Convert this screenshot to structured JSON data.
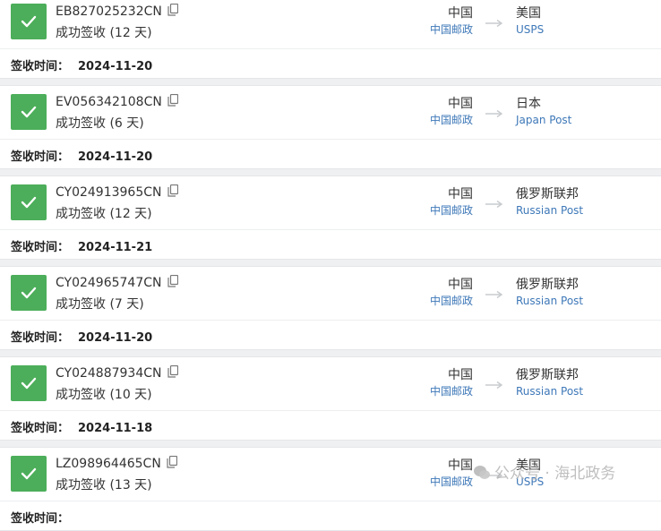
{
  "signed_label": "签收时间：",
  "shipments": [
    {
      "tracking_number": "EB827025232CN",
      "status": "成功签收 (12 天)",
      "origin_country": "中国",
      "origin_carrier": "中国邮政",
      "dest_country": "美国",
      "dest_carrier": "USPS",
      "signed_date": "2024-11-20"
    },
    {
      "tracking_number": "EV056342108CN",
      "status": "成功签收 (6 天)",
      "origin_country": "中国",
      "origin_carrier": "中国邮政",
      "dest_country": "日本",
      "dest_carrier": "Japan Post",
      "signed_date": "2024-11-20"
    },
    {
      "tracking_number": "CY024913965CN",
      "status": "成功签收 (12 天)",
      "origin_country": "中国",
      "origin_carrier": "中国邮政",
      "dest_country": "俄罗斯联邦",
      "dest_carrier": "Russian Post",
      "signed_date": "2024-11-21"
    },
    {
      "tracking_number": "CY024965747CN",
      "status": "成功签收 (7 天)",
      "origin_country": "中国",
      "origin_carrier": "中国邮政",
      "dest_country": "俄罗斯联邦",
      "dest_carrier": "Russian Post",
      "signed_date": "2024-11-20"
    },
    {
      "tracking_number": "CY024887934CN",
      "status": "成功签收 (10 天)",
      "origin_country": "中国",
      "origin_carrier": "中国邮政",
      "dest_country": "俄罗斯联邦",
      "dest_carrier": "Russian Post",
      "signed_date": "2024-11-18"
    },
    {
      "tracking_number": "LZ098964465CN",
      "status": "成功签收 (13 天)",
      "origin_country": "中国",
      "origin_carrier": "中国邮政",
      "dest_country": "美国",
      "dest_carrier": "USPS",
      "signed_date": ""
    }
  ],
  "watermark": "公众号 · 海北政务",
  "colors": {
    "success_green": "#4cae5a",
    "carrier_blue": "#3e78b8"
  },
  "icons": {
    "status": "check-icon",
    "copy": "copy-icon",
    "route": "arrow-right-icon",
    "watermark": "wechat-icon"
  }
}
